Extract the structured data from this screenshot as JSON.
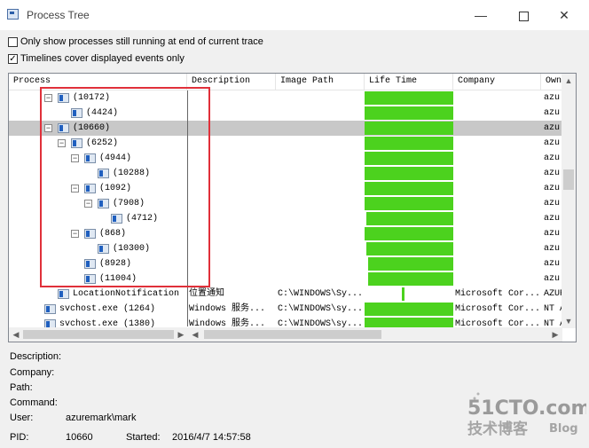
{
  "window": {
    "title": "Process Tree",
    "minimize": "—",
    "close": "✕"
  },
  "options": [
    {
      "label": "Only show processes still running at end of current trace",
      "checked": false
    },
    {
      "label": "Timelines cover displayed events only",
      "checked": true
    }
  ],
  "columns": [
    "Process",
    "Description",
    "Image Path",
    "Life Time",
    "Company",
    "Own"
  ],
  "rows": [
    {
      "name": "(10172)",
      "desc": "",
      "path": "",
      "company": "",
      "owner": "azu",
      "lifetime": [
        0.0,
        1.0
      ],
      "has_expander": true,
      "selected": false
    },
    {
      "name": "(4424)",
      "desc": "",
      "path": "",
      "company": "",
      "owner": "azu",
      "lifetime": [
        0.0,
        1.0
      ],
      "has_expander": false,
      "selected": false
    },
    {
      "name": "(10660)",
      "desc": "",
      "path": "",
      "company": "",
      "owner": "azu",
      "lifetime": [
        0.0,
        1.0
      ],
      "has_expander": true,
      "selected": true
    },
    {
      "name": "(6252)",
      "desc": "",
      "path": "",
      "company": "",
      "owner": "azu",
      "lifetime": [
        0.0,
        1.0
      ],
      "has_expander": true,
      "selected": false
    },
    {
      "name": "(4944)",
      "desc": "",
      "path": "",
      "company": "",
      "owner": "azu",
      "lifetime": [
        0.0,
        1.0
      ],
      "has_expander": true,
      "selected": false
    },
    {
      "name": "(10288)",
      "desc": "",
      "path": "",
      "company": "",
      "owner": "azu",
      "lifetime": [
        0.0,
        1.0
      ],
      "has_expander": false,
      "selected": false
    },
    {
      "name": "(1092)",
      "desc": "",
      "path": "",
      "company": "",
      "owner": "azu",
      "lifetime": [
        0.0,
        1.0
      ],
      "has_expander": true,
      "selected": false
    },
    {
      "name": "(7908)",
      "desc": "",
      "path": "",
      "company": "",
      "owner": "azu",
      "lifetime": [
        0.0,
        1.0
      ],
      "has_expander": true,
      "selected": false
    },
    {
      "name": "(4712)",
      "desc": "",
      "path": "",
      "company": "",
      "owner": "azu",
      "lifetime": [
        0.02,
        1.0
      ],
      "has_expander": false,
      "selected": false
    },
    {
      "name": "(868)",
      "desc": "",
      "path": "",
      "company": "",
      "owner": "azu",
      "lifetime": [
        0.0,
        1.0
      ],
      "has_expander": true,
      "selected": false
    },
    {
      "name": "(10300)",
      "desc": "",
      "path": "",
      "company": "",
      "owner": "azu",
      "lifetime": [
        0.02,
        1.0
      ],
      "has_expander": false,
      "selected": false
    },
    {
      "name": "(8928)",
      "desc": "",
      "path": "",
      "company": "",
      "owner": "azu",
      "lifetime": [
        0.04,
        1.0
      ],
      "has_expander": false,
      "selected": false
    },
    {
      "name": "(11004)",
      "desc": "",
      "path": "",
      "company": "",
      "owner": "azu",
      "lifetime": [
        0.04,
        1.0
      ],
      "has_expander": false,
      "selected": false
    },
    {
      "name": "LocationNotification",
      "desc": "位置通知",
      "path": "C:\\WINDOWS\\Sy...",
      "company": "Microsoft Cor...",
      "owner": "AZUR",
      "lifetime": [
        0.42,
        0.45
      ],
      "has_expander": false,
      "selected": false
    },
    {
      "name": "svchost.exe (1264)",
      "desc": "Windows 服务...",
      "path": "C:\\WINDOWS\\sy...",
      "company": "Microsoft Cor...",
      "owner": "NT A",
      "lifetime": [
        0.0,
        1.0
      ],
      "has_expander": false,
      "selected": false
    },
    {
      "name": "svchost.exe (1380)",
      "desc": "Windows 服务...",
      "path": "C:\\WINDOWS\\sy...",
      "company": "Microsoft Cor...",
      "owner": "NT A",
      "lifetime": [
        0.0,
        1.0
      ],
      "has_expander": false,
      "selected": false
    }
  ],
  "details": {
    "description_label": "Description:",
    "description": "",
    "company_label": "Company:",
    "company": "",
    "path_label": "Path:",
    "path": "",
    "command_label": "Command:",
    "command": "",
    "user_label": "User:",
    "user": "azuremark\\mark",
    "pid_label": "PID:",
    "pid": "10660",
    "started_label": "Started:",
    "started": "2016/4/7 14:57:58"
  },
  "watermark": {
    "site": "51CTO.com",
    "tagline": "技术博客",
    "blog": "Blog"
  },
  "colors": {
    "lifetime_bar": "#4cd21e",
    "selection": "#c8c8c8",
    "highlight_box": "#e0303a"
  }
}
